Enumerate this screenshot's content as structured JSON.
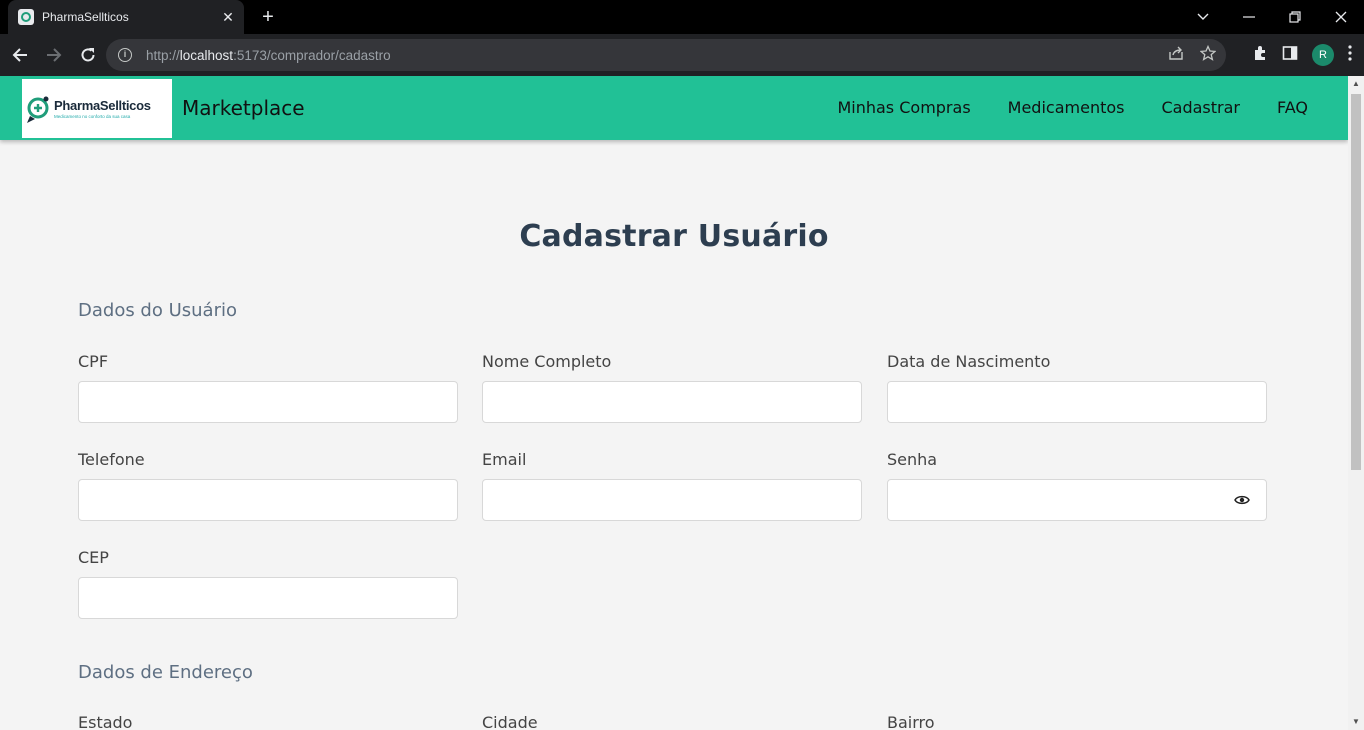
{
  "browser": {
    "tab_title": "PharmaSellticos",
    "tab_close": "✕",
    "new_tab": "+",
    "url_prefix": "http://",
    "url_host": "localhost",
    "url_path": ":5173/comprador/cadastro",
    "profile_initial": "R"
  },
  "navbar": {
    "logo_name": "PharmaSellticos",
    "logo_tagline": "Medicamento no conforto da sua casa",
    "brand": "Marketplace",
    "links": [
      "Minhas Compras",
      "Medicamentos",
      "Cadastrar",
      "FAQ"
    ]
  },
  "page": {
    "title": "Cadastrar Usuário",
    "section_user": "Dados do Usuário",
    "section_address": "Dados de Endereço",
    "fields": {
      "cpf": "CPF",
      "nome": "Nome Completo",
      "nascimento": "Data de Nascimento",
      "telefone": "Telefone",
      "email": "Email",
      "senha": "Senha",
      "cep": "CEP",
      "estado": "Estado",
      "cidade": "Cidade",
      "bairro": "Bairro"
    }
  },
  "colors": {
    "navbar": "#21c196",
    "title": "#2d3e50",
    "section": "#5e6f82"
  }
}
